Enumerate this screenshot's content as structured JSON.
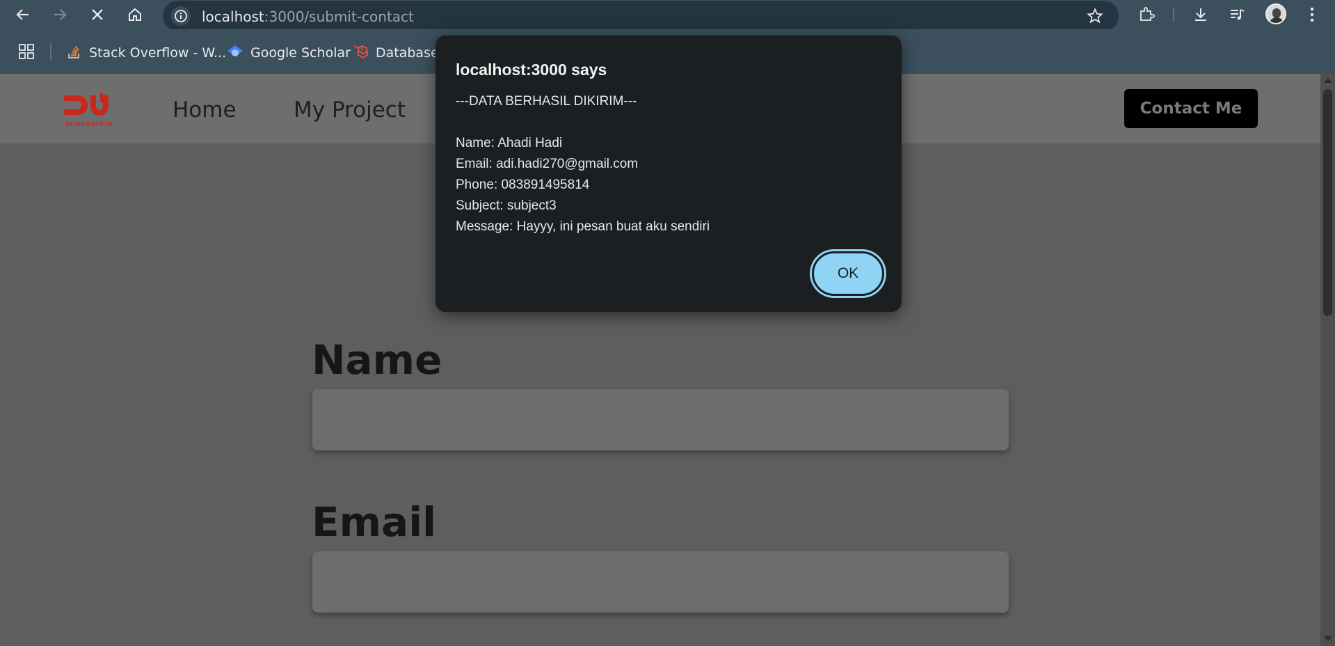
{
  "browser": {
    "url_host": "localhost",
    "url_path": ":3000/submit-contact",
    "bookmarks": [
      {
        "label": "Stack Overflow - W...",
        "icon": "stackoverflow-icon"
      },
      {
        "label": "Google Scholar",
        "icon": "google-scholar-icon"
      },
      {
        "label": "Database: I",
        "icon": "laravel-icon"
      }
    ]
  },
  "navbar": {
    "logo_text": "DUMBWAYS.ID",
    "links": [
      "Home",
      "My Project"
    ],
    "contact_label": "Contact Me"
  },
  "form": {
    "name_label": "Name",
    "email_label": "Email",
    "name_value": "",
    "email_value": ""
  },
  "dialog": {
    "title": "localhost:3000 says",
    "lines": [
      "---DATA BERHASIL DIKIRIM---",
      "",
      "Name: Ahadi Hadi",
      "Email: adi.hadi270@gmail.com",
      "Phone: 083891495814",
      "Subject: subject3",
      "Message: Hayyy, ini pesan buat aku sendiri"
    ],
    "ok_label": "OK"
  },
  "colors": {
    "chrome_bg": "#3b4f5d",
    "dialog_bg": "#1b1f22",
    "ok_button": "#8fd4f4",
    "logo_red": "#c9271c"
  }
}
